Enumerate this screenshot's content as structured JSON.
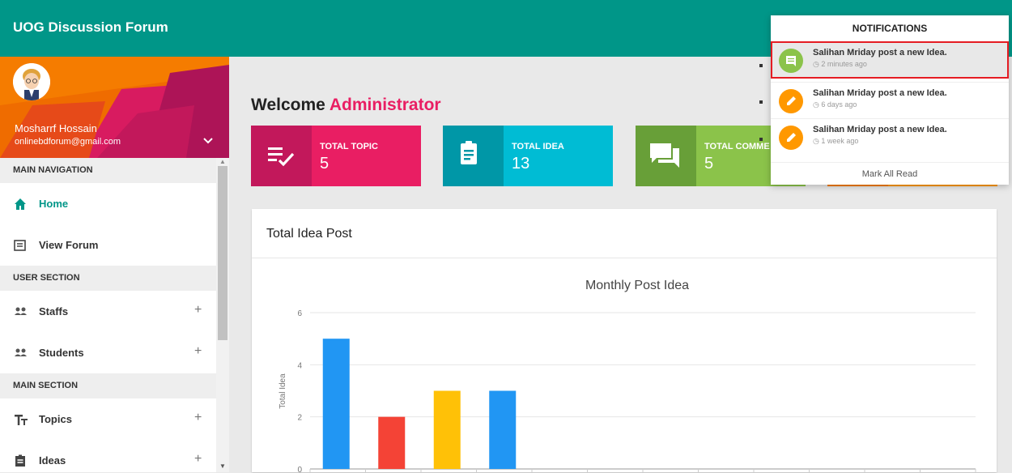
{
  "app": {
    "title": "UOG Discussion Forum"
  },
  "user": {
    "name": "Mosharrf Hossain",
    "email": "onlinebdforum@gmail.com"
  },
  "sidebar": {
    "sections": [
      {
        "header": "MAIN NAVIGATION",
        "items": [
          {
            "label": "Home",
            "icon": "home-icon",
            "active": true
          },
          {
            "label": "View Forum",
            "icon": "forum-icon"
          }
        ]
      },
      {
        "header": "USER SECTION",
        "items": [
          {
            "label": "Staffs",
            "icon": "people-icon",
            "expandable": "+"
          },
          {
            "label": "Students",
            "icon": "people-icon",
            "expandable": "+"
          }
        ]
      },
      {
        "header": "MAIN SECTION",
        "items": [
          {
            "label": "Topics",
            "icon": "text-fields-icon",
            "expandable": "+"
          },
          {
            "label": "Ideas",
            "icon": "assignment-icon",
            "expandable": "+"
          }
        ]
      }
    ]
  },
  "welcome": {
    "prefix": "Welcome",
    "role": "Administrator"
  },
  "cards": [
    {
      "title": "TOTAL TOPIC",
      "value": "5",
      "color": "#e91e63",
      "icon_color": "#c2185b",
      "icon": "playlist-check-icon"
    },
    {
      "title": "TOTAL IDEA",
      "value": "13",
      "color": "#00bcd4",
      "icon_color": "#0097a7",
      "icon": "assignment-icon"
    },
    {
      "title": "TOTAL COMME",
      "value": "5",
      "color": "#8bc34a",
      "icon_color": "#689f38",
      "icon": "forum-icon"
    }
  ],
  "panel": {
    "title": "Total Idea Post"
  },
  "chart_data": {
    "type": "bar",
    "title": "Monthly Post Idea",
    "xlabel": "",
    "ylabel": "Total Idea",
    "ylim": [
      0,
      6
    ],
    "yticks": [
      0,
      2,
      4,
      6
    ],
    "categories": [
      "",
      "",
      "",
      "",
      "",
      "",
      "",
      "",
      "",
      "",
      "",
      ""
    ],
    "values": [
      5,
      2,
      3,
      3,
      0,
      0,
      0,
      0,
      0,
      0,
      0,
      0
    ],
    "colors": [
      "#2196f3",
      "#f44336",
      "#ffc107",
      "#2196f3"
    ],
    "grid": true
  },
  "notifications": {
    "header": "NOTIFICATIONS",
    "items": [
      {
        "text": "Salihan Mriday post a new Idea.",
        "time": "2 minutes ago",
        "color": "#8bc34a",
        "icon": "comment-icon",
        "highlighted": true
      },
      {
        "text": "Salihan Mriday post a new Idea.",
        "time": "6 days ago",
        "color": "#ff9800",
        "icon": "edit-icon"
      },
      {
        "text": "Salihan Mriday post a new Idea.",
        "time": "1 week ago",
        "color": "#ff9800",
        "icon": "edit-icon"
      }
    ],
    "footer": "Mark All Read"
  }
}
